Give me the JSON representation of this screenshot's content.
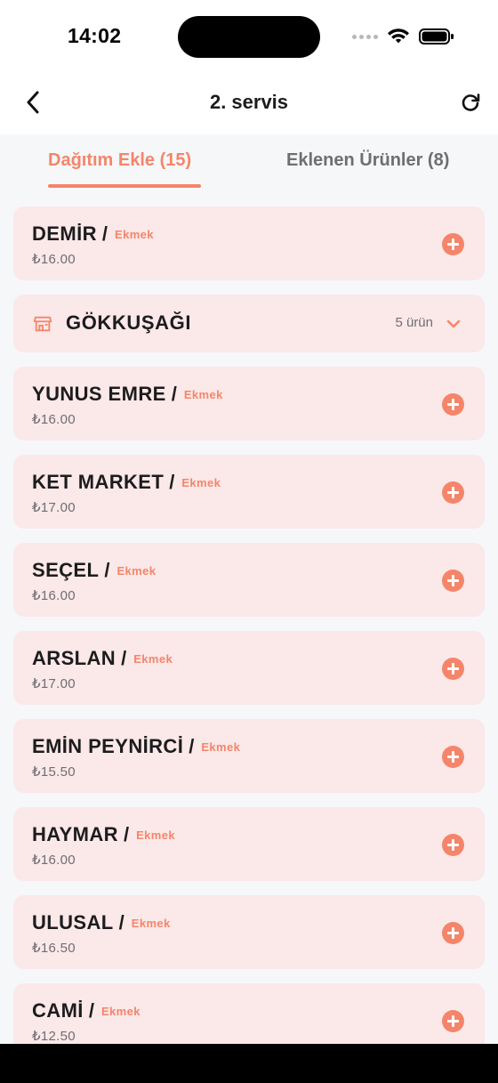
{
  "status_bar": {
    "time": "14:02"
  },
  "nav": {
    "title": "2. servis",
    "back_icon": "chevron-left-icon",
    "refresh_icon": "refresh-icon"
  },
  "tabs": [
    {
      "label": "Dağıtım Ekle (15)",
      "active": true
    },
    {
      "label": "Eklenen Ürünler (8)",
      "active": false
    }
  ],
  "colors": {
    "accent": "#f5856a",
    "card_bg": "#fbe8e8",
    "page_bg": "#f6f7f9"
  },
  "items": [
    {
      "type": "customer",
      "name": "DEMİR",
      "separator": "/",
      "category": "Ekmek",
      "price": "₺16.00"
    },
    {
      "type": "group",
      "name": "GÖKKUŞAĞI",
      "count": "5 ürün",
      "icon": "store-icon"
    },
    {
      "type": "customer",
      "name": "YUNUS EMRE",
      "separator": "/",
      "category": "Ekmek",
      "price": "₺16.00"
    },
    {
      "type": "customer",
      "name": "KET MARKET",
      "separator": "/",
      "category": "Ekmek",
      "price": "₺17.00"
    },
    {
      "type": "customer",
      "name": "SEÇEL",
      "separator": "/",
      "category": "Ekmek",
      "price": "₺16.00"
    },
    {
      "type": "customer",
      "name": "ARSLAN",
      "separator": "/",
      "category": "Ekmek",
      "price": "₺17.00"
    },
    {
      "type": "customer",
      "name": "EMİN PEYNİRCİ",
      "separator": "/",
      "category": "Ekmek",
      "price": "₺15.50"
    },
    {
      "type": "customer",
      "name": "HAYMAR",
      "separator": "/",
      "category": "Ekmek",
      "price": "₺16.00"
    },
    {
      "type": "customer",
      "name": "ULUSAL",
      "separator": "/",
      "category": "Ekmek",
      "price": "₺16.50"
    },
    {
      "type": "customer",
      "name": "CAMİ",
      "separator": "/",
      "category": "Ekmek",
      "price": "₺12.50"
    }
  ]
}
